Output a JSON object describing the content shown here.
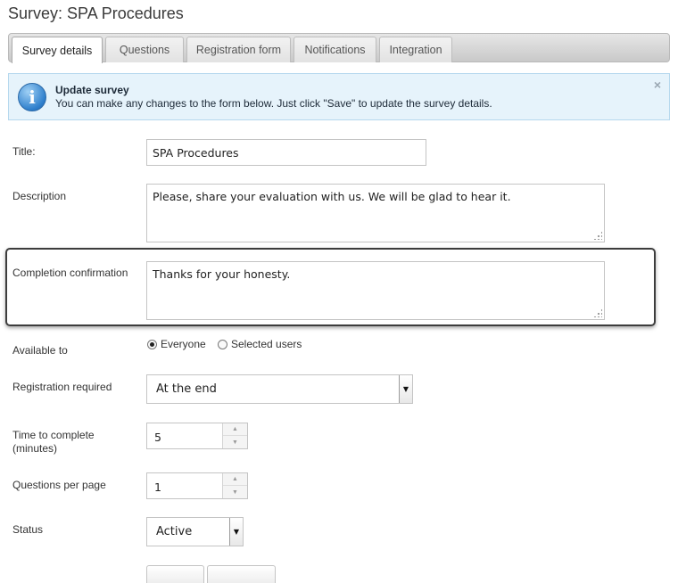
{
  "page": {
    "title": "Survey: SPA Procedures"
  },
  "tabs": [
    {
      "label": "Survey details",
      "active": true
    },
    {
      "label": "Questions",
      "active": false
    },
    {
      "label": "Registration form",
      "active": false
    },
    {
      "label": "Notifications",
      "active": false
    },
    {
      "label": "Integration",
      "active": false
    }
  ],
  "notice": {
    "icon": "info-icon",
    "title": "Update survey",
    "text": "You can make any changes to the form below. Just click \"Save\" to update the survey details.",
    "close": "×"
  },
  "form": {
    "title": {
      "label": "Title:",
      "value": "SPA Procedures"
    },
    "description": {
      "label": "Description",
      "value": "Please, share your evaluation with us. We will be glad to hear it."
    },
    "completion": {
      "label": "Completion confirmation",
      "value": "Thanks for your honesty."
    },
    "available": {
      "label": "Available to",
      "options": [
        {
          "label": "Everyone",
          "checked": true
        },
        {
          "label": "Selected users",
          "checked": false
        }
      ]
    },
    "registration": {
      "label": "Registration required",
      "value": "At the end"
    },
    "time": {
      "label_line1": "Time to complete",
      "label_line2": "(minutes)",
      "value": "5"
    },
    "questions_per_page": {
      "label": "Questions per page",
      "value": "1"
    },
    "status": {
      "label": "Status",
      "value": "Active"
    }
  },
  "colors": {
    "notice_bg": "#e6f3fb",
    "notice_border": "#b6d8ee",
    "highlight_border": "#3d3d3d"
  }
}
